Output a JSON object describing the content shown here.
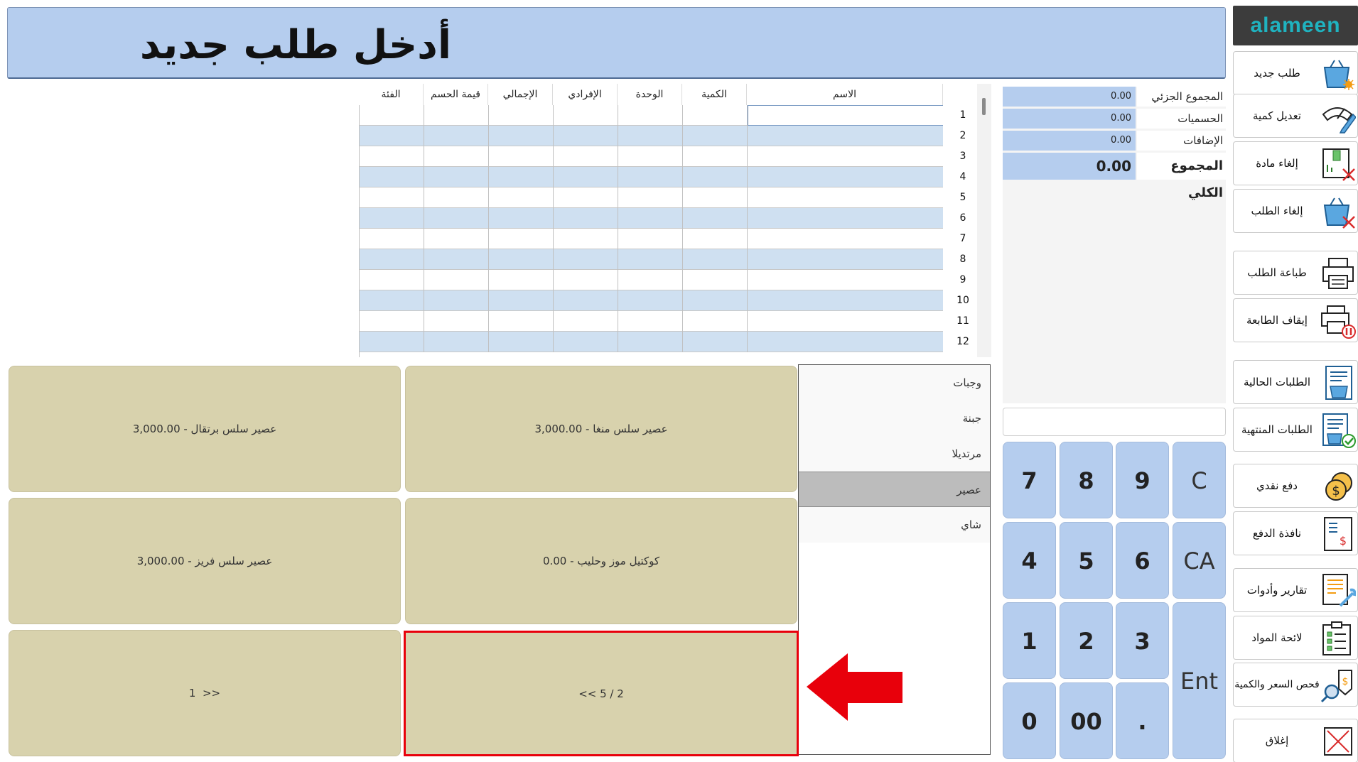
{
  "header": {
    "title": "أدخل طلب جديد"
  },
  "logo": {
    "text": "alameen",
    "color": "#1fb3c0"
  },
  "sidebar": {
    "buttons": [
      {
        "label": "طلب جديد",
        "icon": "basket-new-icon"
      },
      {
        "label": "تعديل كمية",
        "icon": "scale-edit-icon"
      },
      {
        "label": "إلغاء مادة",
        "icon": "item-cancel-icon"
      },
      {
        "label": "إلغاء الطلب",
        "icon": "basket-cancel-icon"
      },
      {
        "label": "طباعة الطلب",
        "icon": "printer-icon"
      },
      {
        "label": "إيقاف الطابعة",
        "icon": "printer-pause-icon"
      },
      {
        "label": "الطلبات الحالية",
        "icon": "current-orders-icon"
      },
      {
        "label": "الطلبات المنتهية",
        "icon": "finished-orders-icon"
      },
      {
        "label": "دفع نقدي",
        "icon": "cash-coins-icon"
      },
      {
        "label": "نافذة الدفع",
        "icon": "payment-window-icon"
      },
      {
        "label": "تقارير وأدوات",
        "icon": "reports-tools-icon"
      },
      {
        "label": "لائحة المواد",
        "icon": "items-list-icon"
      },
      {
        "label": "فحص السعر والكمية",
        "icon": "price-check-icon"
      },
      {
        "label": "إغلاق",
        "icon": "close-icon"
      }
    ]
  },
  "totals": {
    "subtotal_label": "المجموع الجزئي",
    "subtotal_value": "0.00",
    "discounts_label": "الحسميات",
    "discounts_value": "0.00",
    "additions_label": "الإضافات",
    "additions_value": "0.00",
    "grand_total_label": "المجموع الكلي",
    "grand_total_value": "0.00"
  },
  "keypad": {
    "keys": [
      "7",
      "8",
      "9",
      "C",
      "4",
      "5",
      "6",
      "CA",
      "1",
      "2",
      "3",
      "Ent",
      "0",
      "00",
      "."
    ]
  },
  "grid": {
    "columns": [
      "الفئة",
      "قيمة الحسم",
      "الإجمالي",
      "الإفرادي",
      "الوحدة",
      "الكمية",
      "الاسم"
    ],
    "row_numbers": [
      "1",
      "2",
      "3",
      "4",
      "5",
      "6",
      "7",
      "8",
      "9",
      "10",
      "11",
      "12"
    ]
  },
  "categories": [
    {
      "label": "وجبات",
      "active": false
    },
    {
      "label": "جبنة",
      "active": false
    },
    {
      "label": "مرتديلا",
      "active": false
    },
    {
      "label": "عصير",
      "active": true
    },
    {
      "label": "شاي",
      "active": false
    }
  ],
  "products": [
    {
      "label": "عصير سلس منغا - 3,000.00"
    },
    {
      "label": "عصير سلس برتقال - 3,000.00"
    },
    {
      "label": "كوكتيل موز وحليب - 0.00"
    },
    {
      "label": "عصير سلس فريز - 3,000.00"
    },
    {
      "label": "<< 5 / 2"
    },
    {
      "label": "1  >>"
    }
  ],
  "colors": {
    "accent_blue": "#b5cdee",
    "tile": "#d8d2ad",
    "highlight_red": "#e8000b"
  }
}
